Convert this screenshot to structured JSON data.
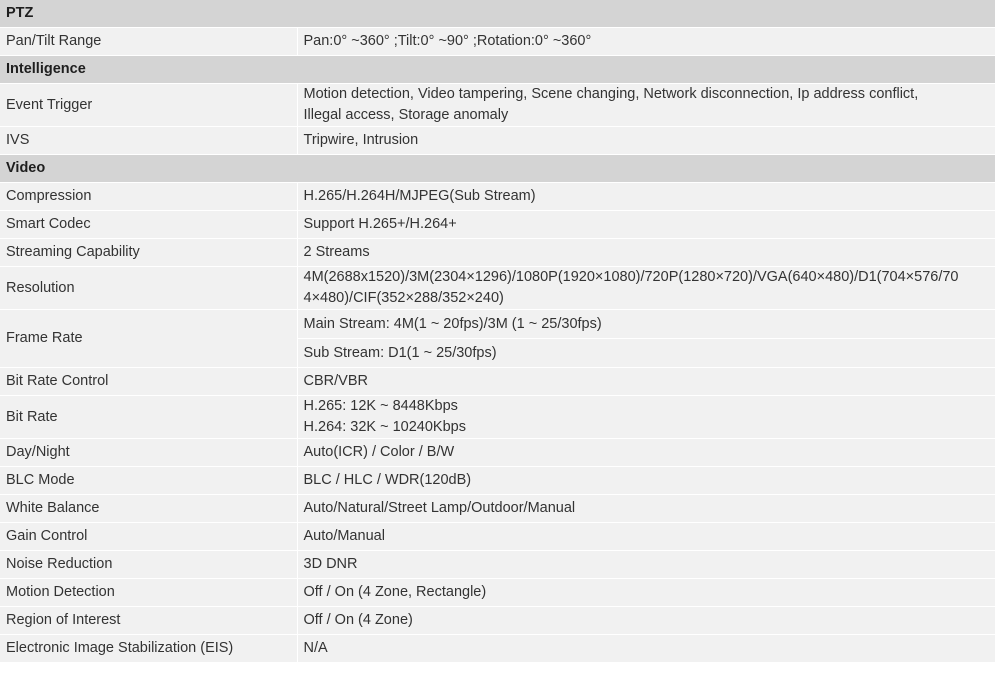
{
  "sections": [
    {
      "title": "PTZ",
      "rows": [
        {
          "label": "Pan/Tilt Range",
          "lines": [
            "Pan:0° ~360° ;Tilt:0° ~90° ;Rotation:0° ~360°"
          ]
        }
      ]
    },
    {
      "title": "Intelligence",
      "rows": [
        {
          "label": "Event Trigger",
          "lines": [
            "Motion detection, Video tampering, Scene changing, Network disconnection, Ip address conflict,",
            "Illegal access, Storage anomaly"
          ]
        },
        {
          "label": "IVS",
          "lines": [
            "Tripwire, Intrusion"
          ]
        }
      ]
    },
    {
      "title": "Video",
      "rows": [
        {
          "label": "Compression",
          "lines": [
            "H.265/H.264H/MJPEG(Sub Stream)"
          ]
        },
        {
          "label": "Smart Codec",
          "lines": [
            "Support H.265+/H.264+"
          ]
        },
        {
          "label": "Streaming Capability",
          "lines": [
            "2 Streams"
          ]
        },
        {
          "label": "Resolution",
          "lines": [
            "4M(2688x1520)/3M(2304×1296)/1080P(1920×1080)/720P(1280×720)/VGA(640×480)/D1(704×576/70",
            "4×480)/CIF(352×288/352×240)"
          ]
        },
        {
          "label": "Frame Rate",
          "sub": [
            "Main Stream: 4M(1 ~ 20fps)/3M (1 ~ 25/30fps)",
            "Sub Stream: D1(1 ~ 25/30fps)"
          ]
        },
        {
          "label": "Bit Rate Control",
          "lines": [
            "CBR/VBR"
          ]
        },
        {
          "label": "Bit Rate",
          "lines": [
            "H.265: 12K ~ 8448Kbps",
            "H.264: 32K ~ 10240Kbps"
          ]
        },
        {
          "label": "Day/Night",
          "lines": [
            "Auto(ICR) / Color / B/W"
          ]
        },
        {
          "label": "BLC Mode",
          "lines": [
            "BLC / HLC / WDR(120dB)"
          ]
        },
        {
          "label": "White Balance",
          "lines": [
            "Auto/Natural/Street Lamp/Outdoor/Manual"
          ]
        },
        {
          "label": "Gain Control",
          "lines": [
            "Auto/Manual"
          ]
        },
        {
          "label": "Noise Reduction",
          "lines": [
            "3D DNR"
          ]
        },
        {
          "label": "Motion Detection",
          "lines": [
            "Off / On (4 Zone, Rectangle)"
          ]
        },
        {
          "label": "Region of Interest",
          "lines": [
            "Off / On (4 Zone)"
          ]
        },
        {
          "label": "Electronic Image Stabilization (EIS)",
          "lines": [
            "N/A"
          ]
        }
      ]
    }
  ]
}
